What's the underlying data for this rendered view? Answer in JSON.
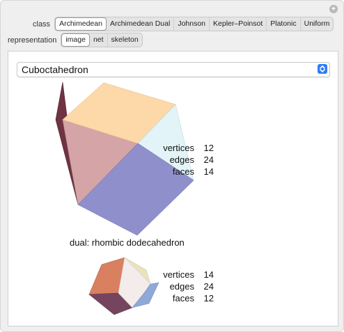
{
  "controls": {
    "class_label": "class",
    "class_options": [
      "Archimedean",
      "Archimedean Dual",
      "Johnson",
      "Kepler–Poinsot",
      "Platonic",
      "Uniform"
    ],
    "class_selected": "Archimedean",
    "representation_label": "representation",
    "representation_options": [
      "image",
      "net",
      "skeleton"
    ],
    "representation_selected": "image",
    "reset_icon": "plus-circle-icon"
  },
  "selector": {
    "value": "Cuboctahedron",
    "icon": "updown-chevron-icon"
  },
  "main_polyhedron": {
    "name": "Cuboctahedron",
    "stats": [
      {
        "name": "vertices",
        "value": "12"
      },
      {
        "name": "edges",
        "value": "24"
      },
      {
        "name": "faces",
        "value": "14"
      }
    ],
    "colors": {
      "top": "#fdd8a8",
      "left": "#d4a4a6",
      "front": "#8f90cb",
      "right": "#e2f4f7",
      "side": "#6f3341"
    }
  },
  "dual": {
    "label": "dual: rhombic dodecahedron",
    "stats": [
      {
        "name": "vertices",
        "value": "14"
      },
      {
        "name": "edges",
        "value": "24"
      },
      {
        "name": "faces",
        "value": "12"
      }
    ],
    "colors": {
      "left_top": "#d98060",
      "front": "#f3eceb",
      "bottom": "#754560",
      "right": "#8fa9d6",
      "top": "#e9e4bf",
      "side": "#5e3745"
    }
  }
}
